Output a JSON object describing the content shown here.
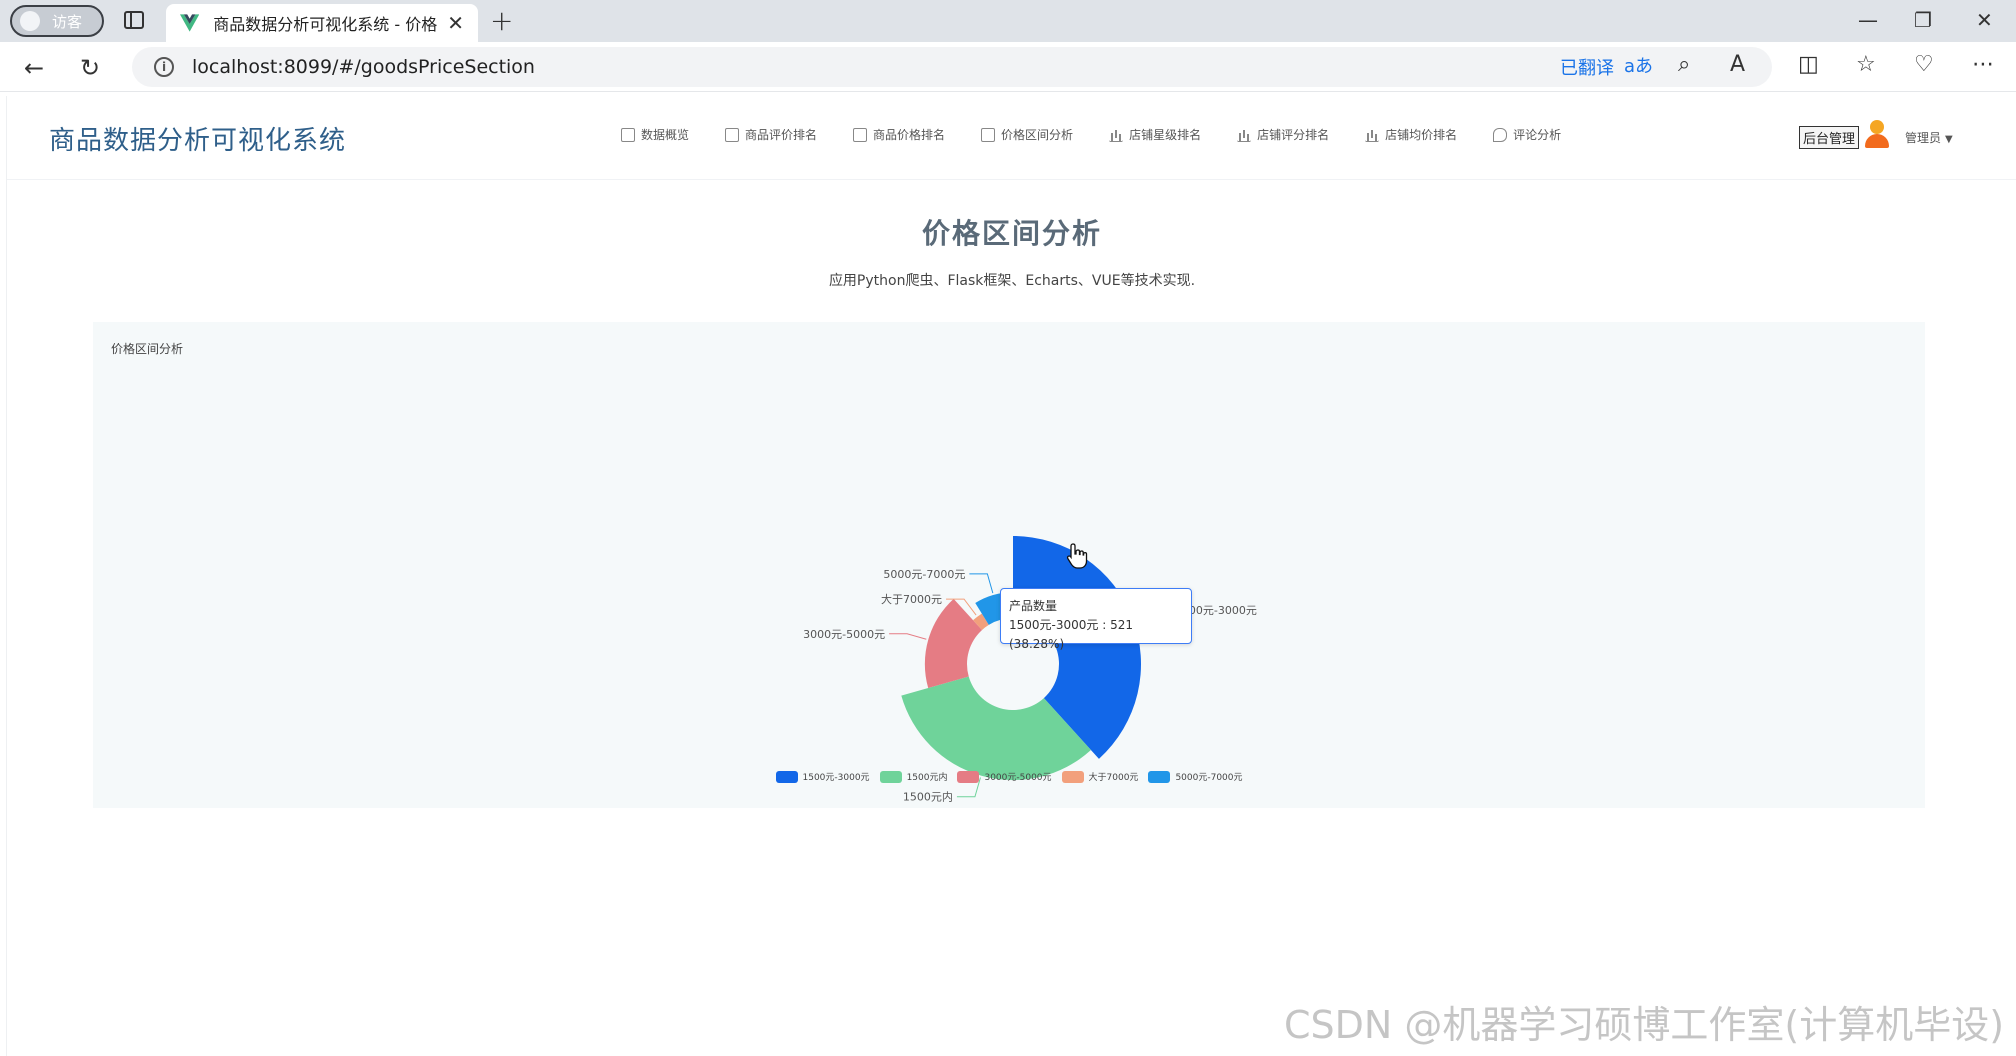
{
  "browser": {
    "profile_label": "访客",
    "tab_title": "商品数据分析可视化系统 - 价格区间分析",
    "tab_close": "✕",
    "new_tab": "+",
    "url": "localhost:8099/#/goodsPriceSection",
    "translated_label": "已翻译"
  },
  "app": {
    "brand": "商品数据分析可视化系统",
    "menu": [
      {
        "label": "数据概览",
        "icon": "doc-icon"
      },
      {
        "label": "商品评价排名",
        "icon": "list-icon"
      },
      {
        "label": "商品价格排名",
        "icon": "list-icon"
      },
      {
        "label": "价格区间分析",
        "icon": "list-icon"
      },
      {
        "label": "店铺星级排名",
        "icon": "bar-chart-icon"
      },
      {
        "label": "店铺评分排名",
        "icon": "bar-chart-icon"
      },
      {
        "label": "店铺均价排名",
        "icon": "bar-chart-icon"
      },
      {
        "label": "评论分析",
        "icon": "comment-icon"
      }
    ],
    "admin_button": "后台管理",
    "user_name": "管理员"
  },
  "page": {
    "title": "价格区间分析",
    "subtitle": "应用Python爬虫、Flask框架、Echarts、VUE等技术实现.",
    "panel_title": "价格区间分析"
  },
  "tooltip": {
    "series_name": "产品数量",
    "line": "1500元-3000元 : 521 (38.28%)"
  },
  "chart_data": {
    "type": "pie",
    "variant": "rose-donut",
    "series_name": "产品数量",
    "categories": [
      "1500元-3000元",
      "1500元内",
      "3000元-5000元",
      "大于7000元",
      "5000元-7000元"
    ],
    "values": [
      521,
      440,
      240,
      40,
      120
    ],
    "colors": [
      "#1267e8",
      "#6fd39a",
      "#e57c84",
      "#f2a07c",
      "#2196e8"
    ],
    "legend_position": "bottom"
  },
  "watermark": "CSDN @机器学习硕博工作室(计算机毕设)"
}
